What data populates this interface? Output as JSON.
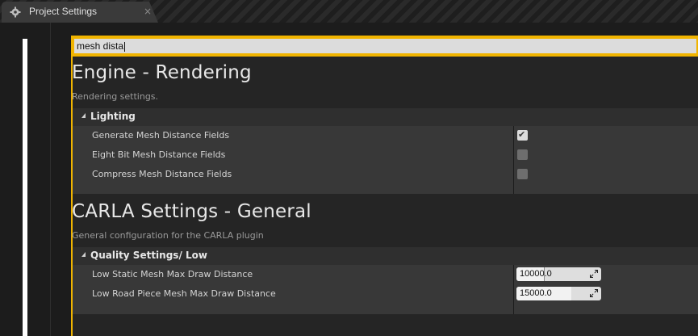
{
  "tab": {
    "title": "Project Settings",
    "close_glyph": "×",
    "icon": "settings-gear-icon"
  },
  "search": {
    "value": "mesh dista"
  },
  "sections": [
    {
      "title": "Engine - Rendering",
      "description": "Rendering settings.",
      "category": {
        "label": "Lighting",
        "rows": [
          {
            "label": "Generate Mesh Distance Fields",
            "checked": true
          },
          {
            "label": "Eight Bit Mesh Distance Fields",
            "checked": false
          },
          {
            "label": "Compress Mesh Distance Fields",
            "checked": false
          }
        ]
      }
    },
    {
      "title": "CARLA Settings - General",
      "description": "General configuration for the CARLA plugin",
      "category": {
        "label": "Quality Settings/ Low",
        "rows": [
          {
            "label": "Low Static Mesh Max Draw Distance",
            "value": "10000.0"
          },
          {
            "label": "Low Road Piece Mesh Max Draw Distance",
            "value": "15000.0"
          }
        ]
      }
    }
  ],
  "colors": {
    "accent": "#f0b400",
    "panel": "#252525",
    "row": "#383838",
    "category": "#2f2f2f"
  }
}
